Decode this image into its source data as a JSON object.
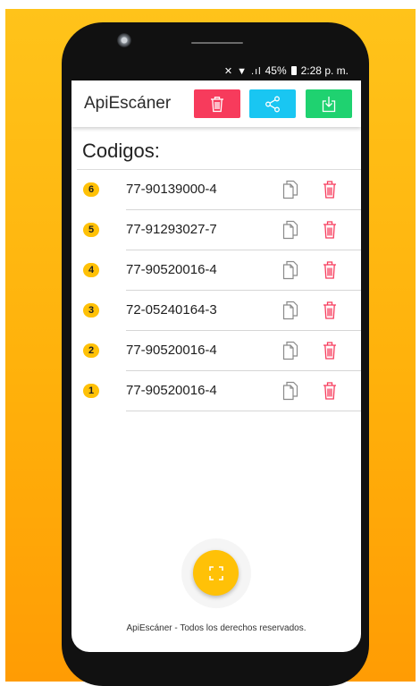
{
  "status_bar": {
    "battery": "45%",
    "time": "2:28 p. m."
  },
  "app_bar": {
    "title": "ApiEscáner"
  },
  "list": {
    "heading": "Codigos:",
    "items": [
      {
        "index": "6",
        "code": "77-90139000-4"
      },
      {
        "index": "5",
        "code": "77-91293027-7"
      },
      {
        "index": "4",
        "code": "77-90520016-4"
      },
      {
        "index": "3",
        "code": "72-05240164-3"
      },
      {
        "index": "2",
        "code": "77-90520016-4"
      },
      {
        "index": "1",
        "code": "77-90520016-4"
      }
    ]
  },
  "footer": {
    "text": "ApiEscáner - Todos los derechos reservados."
  },
  "icons": {
    "delete_all": "trash-icon",
    "share": "share-icon",
    "download": "download-icon",
    "copy": "copy-icon",
    "delete_item": "trash-icon",
    "scan": "scan-icon"
  },
  "colors": {
    "delete_button": "#f73b5c",
    "share_button": "#19c6f2",
    "download_button": "#1fd270",
    "badge": "#ffc107",
    "fab": "#ffc107",
    "delete_icon": "#f73b5c",
    "background": "#ffb10b"
  }
}
